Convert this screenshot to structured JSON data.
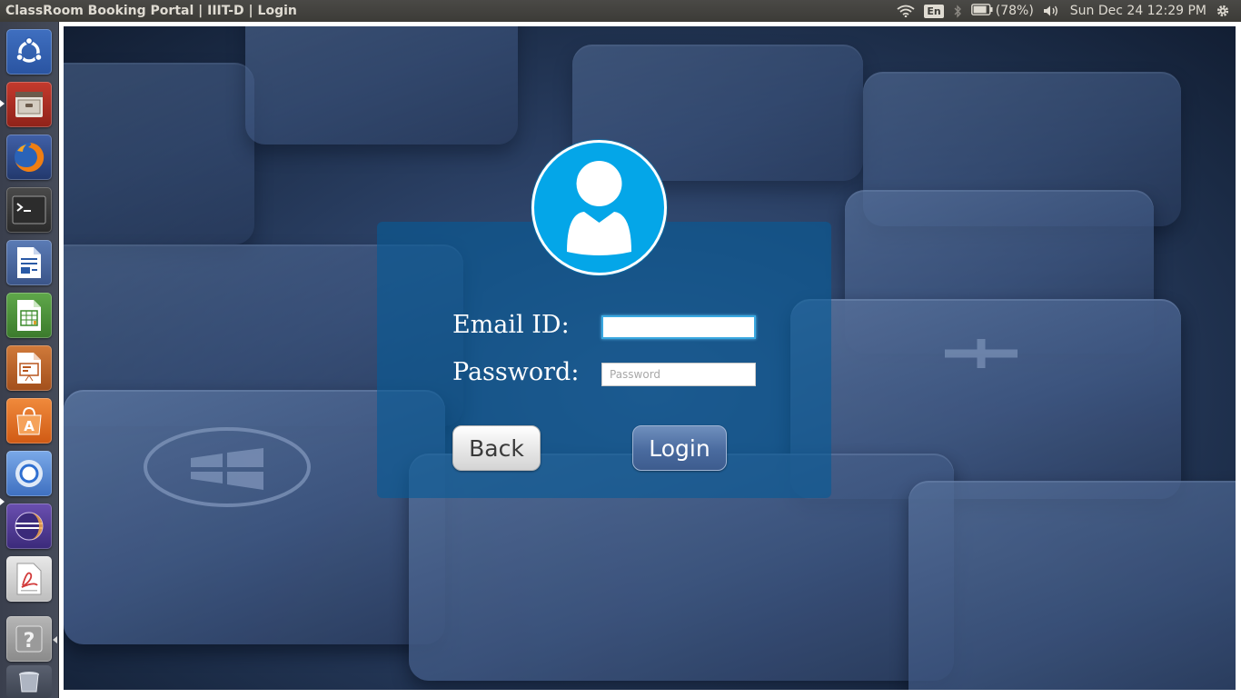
{
  "window": {
    "title": "ClassRoom Booking Portal | IIIT-D | Login"
  },
  "top_panel": {
    "keyboard_layout": "En",
    "battery": "(78%)",
    "datetime": "Sun Dec 24 12:29 PM",
    "icons": [
      "wifi-icon",
      "bluetooth-icon",
      "battery-icon",
      "volume-icon",
      "gear-icon"
    ]
  },
  "launcher": {
    "items": [
      {
        "name": "ubuntu-dash",
        "icon": "ubuntu-logo-icon"
      },
      {
        "name": "files",
        "icon": "file-cabinet-icon"
      },
      {
        "name": "firefox",
        "icon": "firefox-icon"
      },
      {
        "name": "terminal",
        "icon": "terminal-icon"
      },
      {
        "name": "libreoffice-writer",
        "icon": "writer-icon"
      },
      {
        "name": "libreoffice-calc",
        "icon": "calc-icon"
      },
      {
        "name": "libreoffice-impress",
        "icon": "impress-icon"
      },
      {
        "name": "ubuntu-software",
        "icon": "software-center-icon"
      },
      {
        "name": "chromium",
        "icon": "chromium-icon"
      },
      {
        "name": "eclipse",
        "icon": "eclipse-icon"
      },
      {
        "name": "pdf-viewer",
        "icon": "pdf-icon"
      },
      {
        "name": "help",
        "icon": "help-icon"
      },
      {
        "name": "trash",
        "icon": "trash-icon"
      }
    ]
  },
  "login": {
    "email_label": "Email  ID:",
    "email_value": "",
    "password_label": "Password:",
    "password_placeholder": "Password",
    "back_button": "Back",
    "login_button": "Login"
  },
  "colors": {
    "panel_overlay": "#065a96",
    "avatar_bg": "#04a6e8",
    "login_button": "#4a6b9f",
    "back_button": "#e4e4e4"
  }
}
